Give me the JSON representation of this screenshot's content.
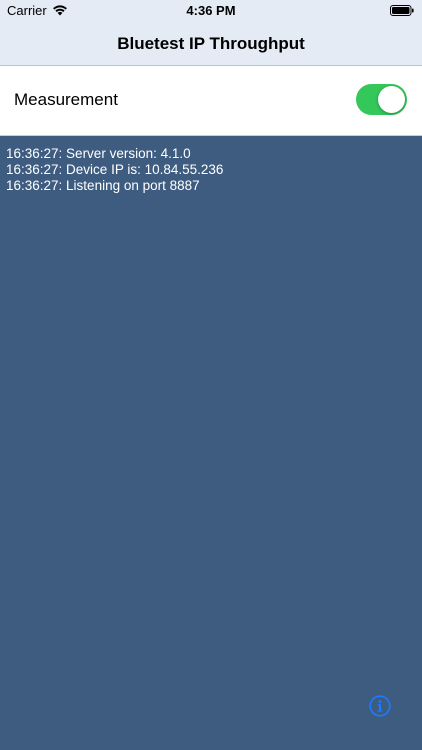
{
  "status_bar": {
    "carrier": "Carrier",
    "time": "4:36 PM",
    "wifi_icon": "wifi-icon",
    "battery_icon": "battery-icon"
  },
  "nav": {
    "title": "Bluetest IP Throughput"
  },
  "measurement": {
    "label": "Measurement",
    "enabled": true,
    "toggle_color": "#34c759"
  },
  "log": {
    "lines": [
      "16:36:27: Server version: 4.1.0",
      "16:36:27: Device IP is: 10.84.55.236",
      "16:36:27: Listening on port 8887"
    ],
    "background_color": "#3e5c80"
  },
  "info_button": {
    "icon": "info-icon",
    "color": "#1a7cff"
  }
}
